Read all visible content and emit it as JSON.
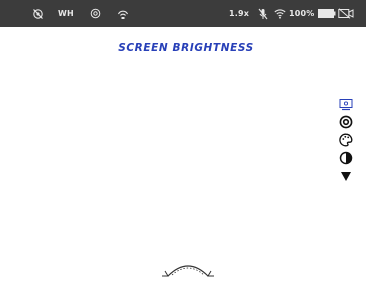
{
  "status_bar": {
    "mode_label": "WH",
    "zoom_label": "1.9x",
    "battery_label": "100%",
    "icons": [
      "no-camera-icon",
      "target-icon",
      "wifi-hotspot-icon",
      "mic-off-icon",
      "wifi-icon",
      "battery-icon",
      "video-off-icon"
    ]
  },
  "screen": {
    "title": "SCREEN BRIGHTNESS"
  },
  "side_menu": {
    "items": [
      {
        "icon": "screen-brightness-icon",
        "selected": true
      },
      {
        "icon": "eye-icon",
        "selected": false
      },
      {
        "icon": "palette-icon",
        "selected": false
      },
      {
        "icon": "contrast-icon",
        "selected": false
      },
      {
        "icon": "more-down-icon",
        "selected": false
      }
    ]
  },
  "controls": {
    "knob_icon": "rotary-knob-icon"
  },
  "colors": {
    "status_bar_bg": "#3c3c3c",
    "title": "#2840b8",
    "selected": "#2840b8"
  }
}
